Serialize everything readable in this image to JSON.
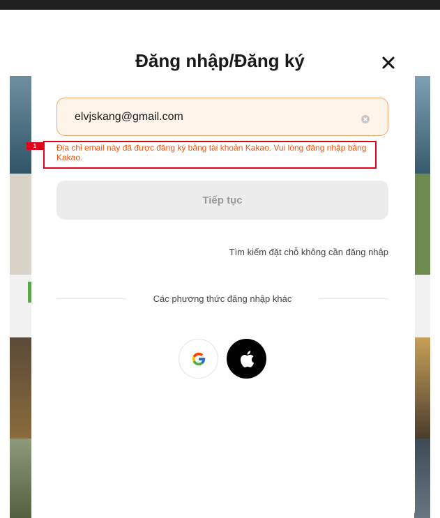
{
  "modal": {
    "title": "Đăng nhập/Đăng ký",
    "close_icon": "close-icon"
  },
  "email": {
    "value": "elvjskang@gmail.com",
    "clear_icon": "clear-icon"
  },
  "error": {
    "badge": "1",
    "message": "Địa chỉ email này đã được đăng ký bằng tài khoản Kakao. Vui lòng đăng nhập bằng Kakao."
  },
  "continue_button": {
    "label": "Tiếp tục"
  },
  "guest_link": {
    "label": "Tìm kiếm đặt chỗ không cần đăng nhập"
  },
  "other_methods": {
    "label": "Các phương thức đăng nhập khác",
    "google_icon": "google-icon",
    "apple_icon": "apple-icon"
  },
  "colors": {
    "accent": "#f5a66a",
    "error": "#f5520c",
    "badge": "#e0001a"
  }
}
